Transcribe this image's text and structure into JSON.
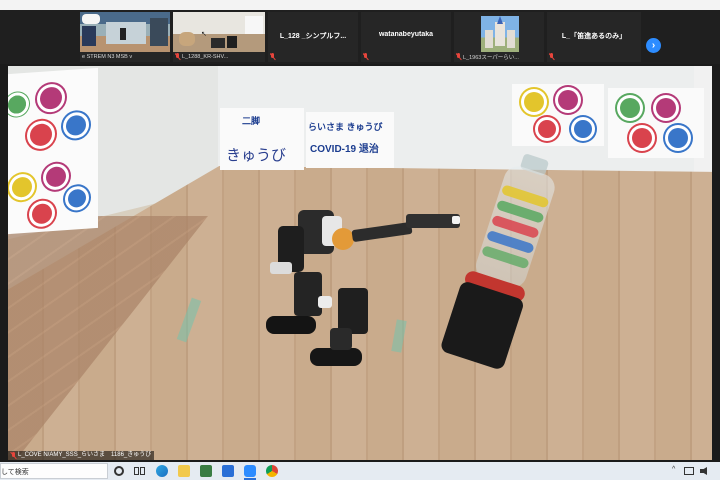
{
  "participants": [
    {
      "name": "",
      "footer": "e STREM N3 MSB v"
    },
    {
      "name": "",
      "footer": "L_1288_KR-SHV..."
    },
    {
      "name": "L_128 _シンプルフ...",
      "footer": ""
    },
    {
      "name": "watanabeyutaka",
      "footer": ""
    },
    {
      "name": "",
      "footer": "L_1963スーパーらい..."
    },
    {
      "name": "L_「笛進あるのみ」",
      "footer": ""
    }
  ],
  "next_button": "›",
  "signs": {
    "kanji_top": "二脚",
    "kanji_bottom": "きゅうび",
    "right_line1": "らいさま きゅうび",
    "right_line2": "COVID-19 退治"
  },
  "video_label": "L_COVE N/AMY_SSS_らいさま　1186_きゅうび",
  "taskbar": {
    "search_text": "して検索",
    "tray_chevron": "^"
  },
  "colors": {
    "zoom_blue": "#2d8cff",
    "muted_red": "#e8453c",
    "virus_red": "#d9434d",
    "virus_green": "#58a860",
    "virus_blue": "#3976c9",
    "virus_magenta": "#b43a78",
    "virus_yellow": "#e3c52c"
  }
}
